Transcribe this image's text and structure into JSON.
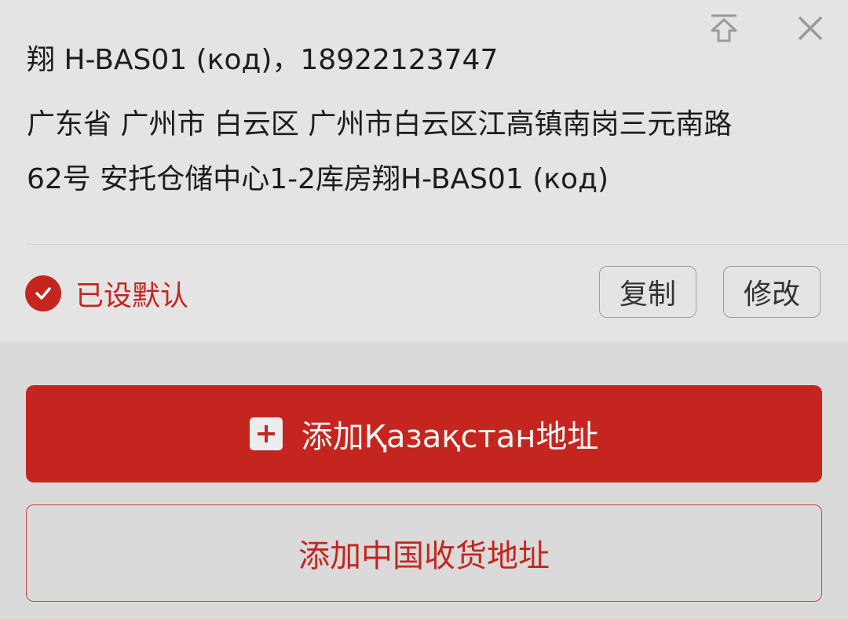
{
  "header": {
    "icons": [
      "pin-top-icon",
      "close-icon"
    ]
  },
  "address_card": {
    "name_line": "翔 H-BAS01 (код)，18922123747",
    "address_line_1": "广东省 广州市 白云区 广州市白云区江高镇南岗三元南路",
    "address_line_2": "62号 安托仓储中心1-2库房翔H-BAS01 (код)",
    "default_label": "已设默认",
    "copy_label": "复制",
    "edit_label": "修改"
  },
  "actions": {
    "add_kz_label": "添加Қазақстан地址",
    "add_cn_label": "添加中国收货地址"
  },
  "colors": {
    "accent": "#c4261f",
    "background": "#dadada",
    "card": "#e4e4e4"
  }
}
